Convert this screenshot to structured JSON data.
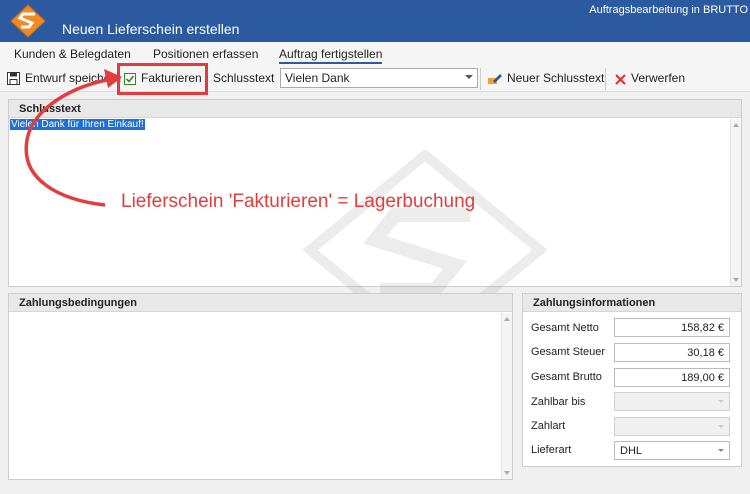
{
  "window": {
    "title": "Neuen Lieferschein erstellen",
    "app_name": "Auftragsbearbeitung in BRUTTO"
  },
  "tabs": [
    {
      "label": "Kunden & Belegdaten"
    },
    {
      "label": "Positionen erfassen"
    },
    {
      "label": "Auftrag fertigstellen"
    }
  ],
  "toolbar": {
    "save_draft": "Entwurf speichern",
    "invoice": "Fakturieren",
    "closing_text_label": "Schlusstext",
    "closing_text_value": "Vielen Dank",
    "new_closing_text": "Neuer Schlusstext",
    "discard": "Verwerfen"
  },
  "closing_text_panel": {
    "header": "Schlusstext",
    "content": "Vielen Dank für Ihren Einkauf!"
  },
  "annotation": "Lieferschein 'Fakturieren' = Lagerbuchung",
  "payment_terms_panel": {
    "header": "Zahlungsbedingungen"
  },
  "payment_info_panel": {
    "header": "Zahlungsinformationen",
    "rows": [
      {
        "label": "Gesamt Netto",
        "value": "158,82 €"
      },
      {
        "label": "Gesamt Steuer",
        "value": "30,18 €"
      },
      {
        "label": "Gesamt Brutto",
        "value": "189,00 €"
      },
      {
        "label": "Zahlbar bis",
        "value": ""
      },
      {
        "label": "Zahlart",
        "value": ""
      },
      {
        "label": "Lieferart",
        "value": "DHL"
      }
    ]
  },
  "colors": {
    "titlebar": "#2c5aa0",
    "annotation_red": "#e23c3c",
    "selection_blue": "#1e6fd9"
  }
}
